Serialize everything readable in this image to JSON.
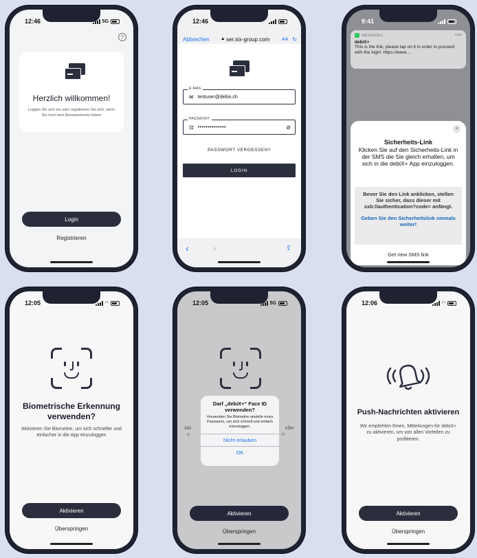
{
  "phone1": {
    "time": "12:46",
    "network": "5G",
    "help_icon": "question-circle-icon",
    "title": "Herzlich willkommen!",
    "subtitle": "Loggen Sie sich ein oder registrieren Sie sich, wenn Sie noch kein Benutzerkonto haben",
    "login_label": "Login",
    "register_label": "Registrieren"
  },
  "phone2": {
    "time": "12:46",
    "cancel_label": "Abbrechen",
    "url": "ser.six-group.com",
    "text_size_label": "AA",
    "email_label": "E-MAIL",
    "email_value": "testuser@debix.ch",
    "password_label": "PASSWORT",
    "password_value": "••••••••••••••",
    "forgot_label": "PASSWORT VERGESSEN?",
    "login_label": "LOGIN"
  },
  "phone3": {
    "time": "9:41",
    "notif_app": "MESSAGES",
    "notif_time": "now",
    "notif_sender": "debiX+",
    "notif_body": "This is the link, please tap on it in order to proceed with the login: https://www....",
    "dialog_title": "Sicherheits-Link",
    "dialog_text": "Klicken Sie auf den Sicherheits-Link in der SMS die Sie gleich erhalten, um sich in die debiX+ App einzuloggen.",
    "warning_text": "Bevor Sie den Link anklicken, stellen Sie sicher, dass dieser mit sxb://authentication?code= anfängt.",
    "warning_link": "Geben Sie den Sicherheitslink niemals weiter!",
    "sms_button": "Get new SMS link"
  },
  "phone4": {
    "time": "12:05",
    "title": "Biometrische Erkennung verwenden?",
    "text": "Aktivieren Sie Biometrie, um sich schneller und einfacher in die App einzuloggen",
    "activate_label": "Aktivieren",
    "skip_label": "Überspringen"
  },
  "phone5": {
    "time": "12:05",
    "network": "5G",
    "bg_text_left": "Akt",
    "bg_text_left2": "u",
    "bg_text_right": "eller",
    "bg_text_right2": "n",
    "alert_title": "Darf „debiX+“ Face ID verwenden?",
    "alert_text": "Verwenden Sie Biometrie anstelle eines Passworts, um sich schnell und einfach einzuloggen.",
    "deny_label": "Nicht erlauben",
    "ok_label": "OK",
    "activate_label": "Aktivieren",
    "skip_label": "Überspringen"
  },
  "phone6": {
    "time": "12:06",
    "title": "Push-Nachrichten aktivieren",
    "text": "Wir empfehlen Ihnen, Mitteilungen für debiX+ zu aktivieren, um von allen Vorteilen zu profitieren.",
    "activate_label": "Aktivieren",
    "skip_label": "Überspringen"
  },
  "colors": {
    "background": "#d9dfef",
    "primary_dark": "#2b2f3d",
    "ios_blue": "#1a73e8",
    "warning_link": "#1767b8"
  }
}
